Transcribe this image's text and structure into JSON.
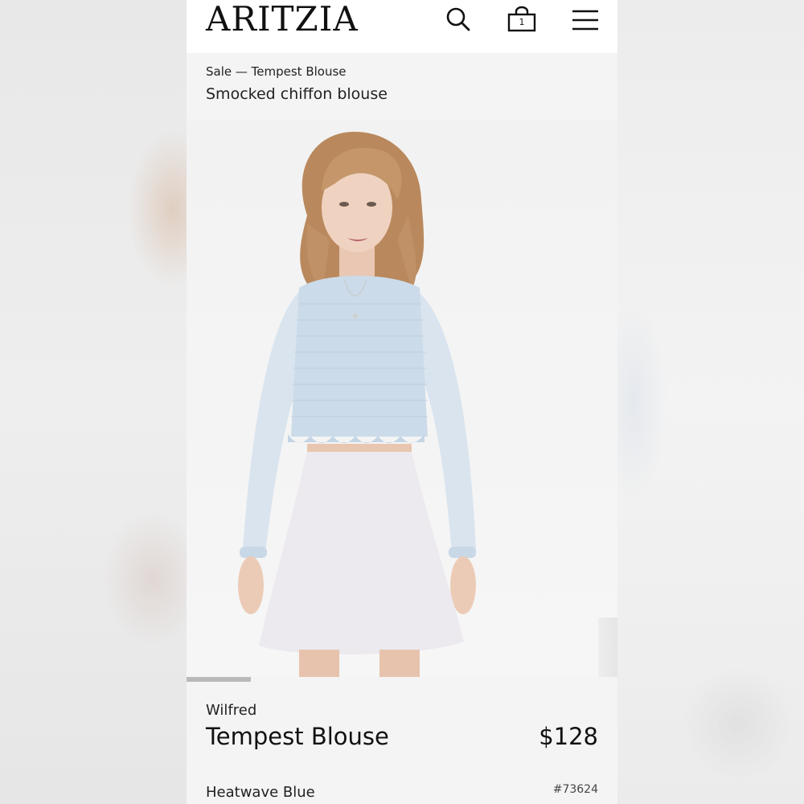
{
  "header": {
    "logo": "ARITZIA",
    "search_icon": "search-icon",
    "bag_icon": "shopping-bag-icon",
    "bag_count": "1",
    "menu_icon": "hamburger-menu-icon"
  },
  "product": {
    "breadcrumb": "Sale — Tempest Blouse",
    "subtitle": "Smocked chiffon blouse",
    "brand": "Wilfred",
    "name": "Tempest Blouse",
    "price": "$128",
    "color": "Heatwave Blue",
    "sku": "#73624"
  },
  "gallery": {
    "image": "model-wearing-light-blue-smocked-chiffon-blouse-and-white-skirt",
    "progress": 0.15
  },
  "colors": {
    "blouse": "#cbdbe9",
    "skirt": "#ece9ef",
    "hair": "#b9895d",
    "text": "#111111"
  }
}
